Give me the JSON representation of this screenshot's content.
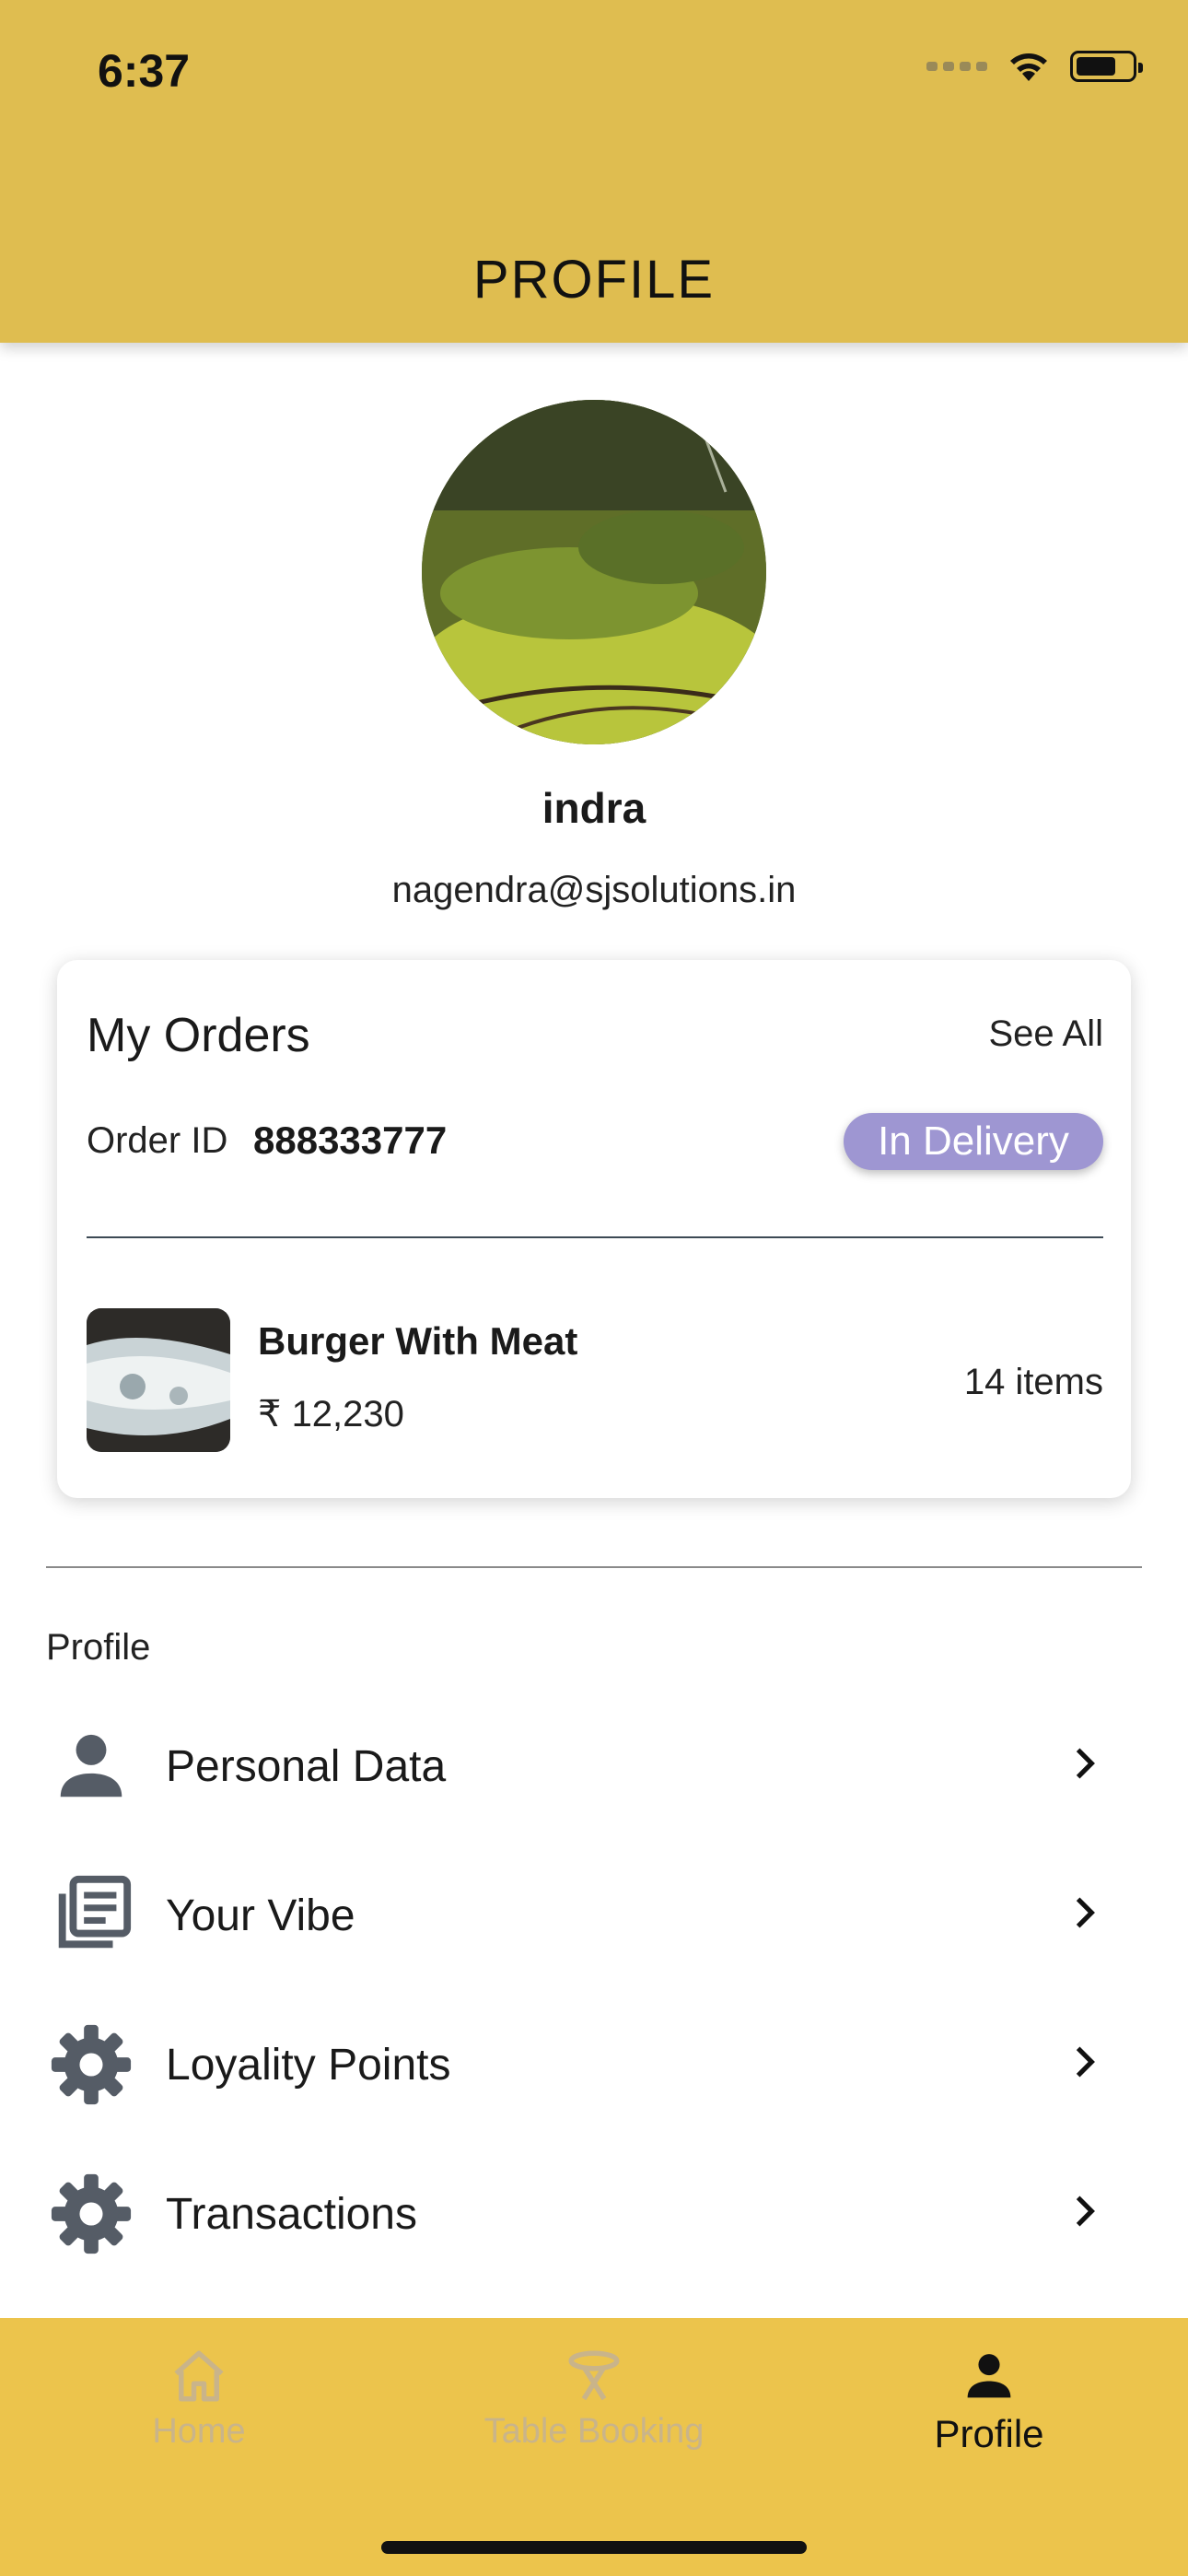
{
  "status_bar": {
    "time": "6:37"
  },
  "header": {
    "title": "PROFILE"
  },
  "profile": {
    "name": "indra",
    "email": "nagendra@sjsolutions.in"
  },
  "orders": {
    "title": "My Orders",
    "see_all": "See All",
    "order_id_label": "Order ID",
    "order_id": "888333777",
    "status": "In Delivery",
    "status_color": "#9e96d2",
    "item": {
      "name": "Burger With Meat",
      "price": "₹ 12,230",
      "count": "14 items"
    }
  },
  "profile_section": {
    "label": "Profile",
    "items": [
      {
        "label": "Personal Data",
        "icon": "person-icon"
      },
      {
        "label": "Your Vibe",
        "icon": "library-books-icon"
      },
      {
        "label": "Loyality Points",
        "icon": "gear-icon"
      },
      {
        "label": "Transactions",
        "icon": "gear-icon"
      }
    ]
  },
  "bottom_nav": {
    "items": [
      {
        "label": "Home",
        "icon": "home-icon",
        "active": false
      },
      {
        "label": "Table Booking",
        "icon": "table-icon",
        "active": false
      },
      {
        "label": "Profile",
        "icon": "person-icon",
        "active": true
      }
    ]
  },
  "colors": {
    "header_bg": "#dfbd50",
    "nav_bg": "#ecc44c",
    "icon_gray": "#555c66"
  }
}
